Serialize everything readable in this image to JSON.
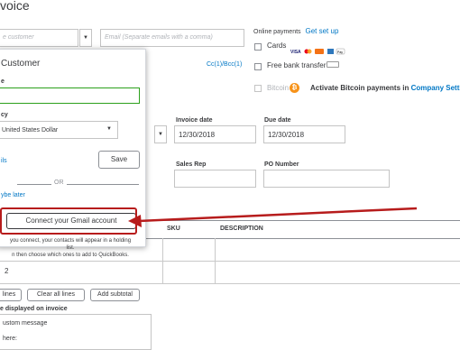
{
  "page": {
    "title": "voice"
  },
  "customer": {
    "placeholder": "e customer",
    "email_placeholder": "Email (Separate emails with a comma)",
    "cc_bcc": "Cc(1)/Bcc(1)"
  },
  "online_payments": {
    "label": "Online payments",
    "setup_link": "Get set up",
    "cards_label": "Cards",
    "bank_label": "Free bank transfer",
    "bitcoin_label": "Bitcoin",
    "bitcoin_activate_text": "Activate Bitcoin payments in",
    "company_settings_link": "Company Settings"
  },
  "panel": {
    "title": "Customer",
    "name_label": "e",
    "currency_label": "cy",
    "currency_value": "United States Dollar",
    "details_link": "ils",
    "save_label": "Save",
    "or_label": "OR",
    "later_link": "ybe later",
    "gmail_button": "Connect your Gmail account",
    "note_line1": "you connect, your contacts will appear in a holding",
    "note_line2": "list.",
    "note_line3": "n then choose which ones to add to QuickBooks."
  },
  "dates": {
    "invoice_date_label": "Invoice date",
    "invoice_date_value": "12/30/2018",
    "due_date_label": "Due date",
    "due_date_value": "12/30/2018"
  },
  "shipping": {
    "sales_rep_label": "Sales Rep",
    "po_number_label": "PO Number"
  },
  "table": {
    "sku_header": "SKU",
    "description_header": "DESCRIPTION",
    "row2_number": "2"
  },
  "actions": {
    "lines_label": "lines",
    "clear_label": "Clear all lines",
    "subtotal_label": "Add subtotal"
  },
  "message": {
    "label": "e displayed on invoice",
    "value": "ustom message",
    "below_label": "here:"
  },
  "colors": {
    "accent": "#0077c5",
    "annotation": "#b71c1c",
    "name_border": "#2ca01c",
    "bitcoin": "#f7931a"
  }
}
